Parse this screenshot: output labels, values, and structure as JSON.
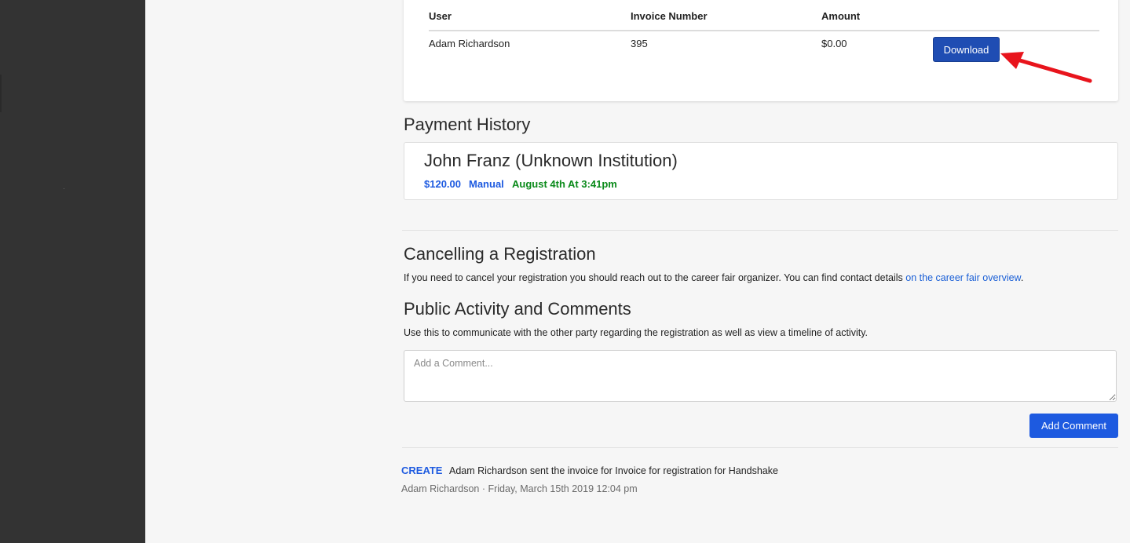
{
  "invoice_table": {
    "headers": {
      "user": "User",
      "invoice_number": "Invoice Number",
      "amount": "Amount"
    },
    "rows": [
      {
        "user": "Adam Richardson",
        "invoice_number": "395",
        "amount": "$0.00",
        "action_label": "Download"
      }
    ]
  },
  "payment_history": {
    "title": "Payment History",
    "entries": [
      {
        "name": "John Franz (Unknown Institution)",
        "amount": "$120.00",
        "method": "Manual",
        "date": "August 4th At 3:41pm"
      }
    ]
  },
  "cancelling": {
    "title": "Cancelling a Registration",
    "text": "If you need to cancel your registration you should reach out to the career fair organizer. You can find contact details ",
    "link_text": "on the career fair overview",
    "suffix": "."
  },
  "comments": {
    "title": "Public Activity and Comments",
    "description": "Use this to communicate with the other party regarding the registration as well as view a timeline of activity.",
    "placeholder": "Add a Comment...",
    "button_label": "Add Comment"
  },
  "activity": [
    {
      "type": "CREATE",
      "text": "Adam Richardson sent the invoice for Invoice for registration for Handshake",
      "meta": "Adam Richardson · Friday, March 15th 2019 12:04 pm"
    }
  ],
  "colors": {
    "sidebar": "#333333",
    "background": "#f6f6f6",
    "primary_button": "#1d5ae0",
    "download_button": "#1f4db3",
    "link": "#1a5fd6",
    "payment_amount": "#1d5ae0",
    "payment_date": "#0a8a1a",
    "annotation_arrow": "#e8141c"
  }
}
